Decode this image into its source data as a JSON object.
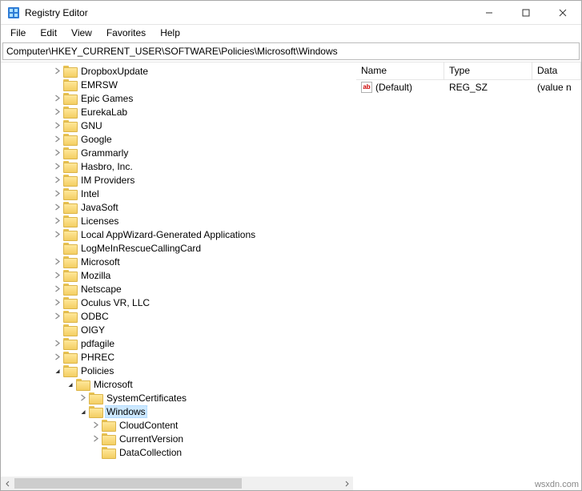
{
  "window": {
    "title": "Registry Editor"
  },
  "menu": {
    "file": "File",
    "edit": "Edit",
    "view": "View",
    "favorites": "Favorites",
    "help": "Help"
  },
  "address": "Computer\\HKEY_CURRENT_USER\\SOFTWARE\\Policies\\Microsoft\\Windows",
  "tree": [
    {
      "indent": 4,
      "twisty": "closed",
      "label": "DropboxUpdate"
    },
    {
      "indent": 4,
      "twisty": "none",
      "label": "EMRSW"
    },
    {
      "indent": 4,
      "twisty": "closed",
      "label": "Epic Games"
    },
    {
      "indent": 4,
      "twisty": "closed",
      "label": "EurekaLab"
    },
    {
      "indent": 4,
      "twisty": "closed",
      "label": "GNU"
    },
    {
      "indent": 4,
      "twisty": "closed",
      "label": "Google"
    },
    {
      "indent": 4,
      "twisty": "closed",
      "label": "Grammarly"
    },
    {
      "indent": 4,
      "twisty": "closed",
      "label": "Hasbro, Inc."
    },
    {
      "indent": 4,
      "twisty": "closed",
      "label": "IM Providers"
    },
    {
      "indent": 4,
      "twisty": "closed",
      "label": "Intel"
    },
    {
      "indent": 4,
      "twisty": "closed",
      "label": "JavaSoft"
    },
    {
      "indent": 4,
      "twisty": "closed",
      "label": "Licenses"
    },
    {
      "indent": 4,
      "twisty": "closed",
      "label": "Local AppWizard-Generated Applications"
    },
    {
      "indent": 4,
      "twisty": "none",
      "label": "LogMeInRescueCallingCard"
    },
    {
      "indent": 4,
      "twisty": "closed",
      "label": "Microsoft"
    },
    {
      "indent": 4,
      "twisty": "closed",
      "label": "Mozilla"
    },
    {
      "indent": 4,
      "twisty": "closed",
      "label": "Netscape"
    },
    {
      "indent": 4,
      "twisty": "closed",
      "label": "Oculus VR, LLC"
    },
    {
      "indent": 4,
      "twisty": "closed",
      "label": "ODBC"
    },
    {
      "indent": 4,
      "twisty": "none",
      "label": "OIGY"
    },
    {
      "indent": 4,
      "twisty": "closed",
      "label": "pdfagile"
    },
    {
      "indent": 4,
      "twisty": "closed",
      "label": "PHREC"
    },
    {
      "indent": 4,
      "twisty": "open",
      "label": "Policies"
    },
    {
      "indent": 5,
      "twisty": "open",
      "label": "Microsoft"
    },
    {
      "indent": 6,
      "twisty": "closed",
      "label": "SystemCertificates"
    },
    {
      "indent": 6,
      "twisty": "open",
      "label": "Windows",
      "selected": true
    },
    {
      "indent": 7,
      "twisty": "closed",
      "label": "CloudContent"
    },
    {
      "indent": 7,
      "twisty": "closed",
      "label": "CurrentVersion"
    },
    {
      "indent": 7,
      "twisty": "none",
      "label": "DataCollection"
    }
  ],
  "list": {
    "headers": {
      "name": "Name",
      "type": "Type",
      "data": "Data"
    },
    "rows": [
      {
        "icon": "ab",
        "name": "(Default)",
        "type": "REG_SZ",
        "data": "(value n"
      }
    ]
  },
  "watermark": "wsxdn.com"
}
